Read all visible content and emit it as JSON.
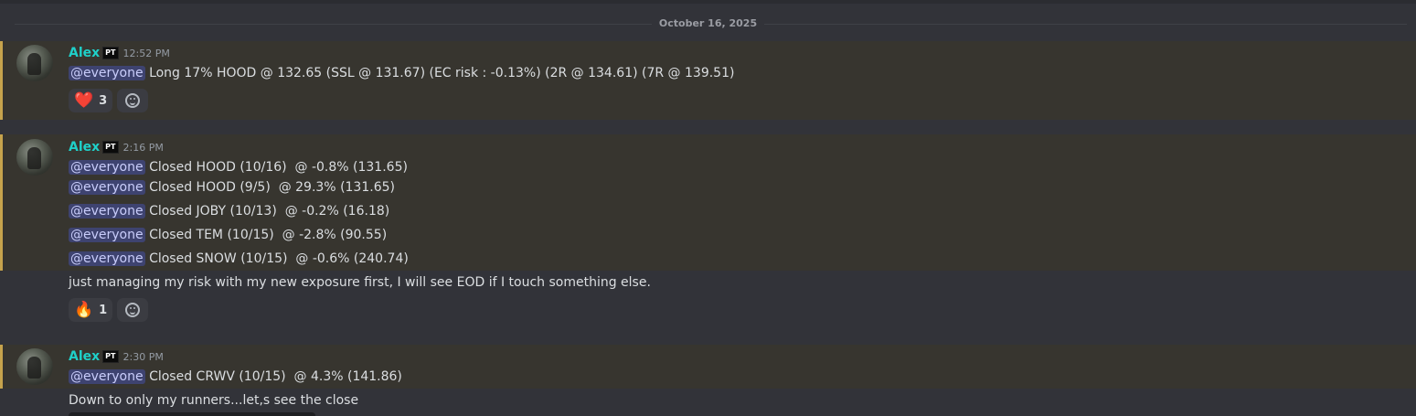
{
  "date_divider": "October 16, 2025",
  "messages": [
    {
      "author": "Alex",
      "tag": "PT",
      "time": "12:52 PM",
      "mention": "@everyone",
      "text": "Long 17% HOOD @ 132.65 (SSL @ 131.67) (EC risk : -0.13%) (2R @ 134.61) (7R @ 139.51)",
      "reaction": {
        "emoji": "heart",
        "glyph": "❤️",
        "count": "3"
      }
    },
    {
      "author": "Alex",
      "tag": "PT",
      "time": "2:16 PM",
      "lines": [
        {
          "mention": "@everyone",
          "text": "Closed HOOD (10/16)  @ -0.8% (131.65)"
        },
        {
          "mention": "@everyone",
          "text": "Closed HOOD (9/5)  @ 29.3% (131.65)"
        },
        {
          "mention": "@everyone",
          "text": "Closed JOBY (10/13)  @ -0.2% (16.18)"
        },
        {
          "mention": "@everyone",
          "text": "Closed TEM (10/15)  @ -2.8% (90.55)"
        },
        {
          "mention": "@everyone",
          "text": "Closed SNOW (10/15)  @ -0.6% (240.74)"
        }
      ],
      "followup": "just managing my risk with my new exposure first, I will see EOD if I touch something else.",
      "reaction": {
        "emoji": "fire",
        "glyph": "🔥",
        "count": "1"
      }
    },
    {
      "author": "Alex",
      "tag": "PT",
      "time": "2:30 PM",
      "mention": "@everyone",
      "text": "Closed CRWV (10/15)  @ 4.3% (141.86)",
      "followup": "Down to only my runners...let,s see the close"
    }
  ],
  "colors": {
    "username": "#1fd0c9",
    "mention_bar": "#c6a34c",
    "mention_bg": "#37352f",
    "mention_pill": "#3e4370"
  }
}
